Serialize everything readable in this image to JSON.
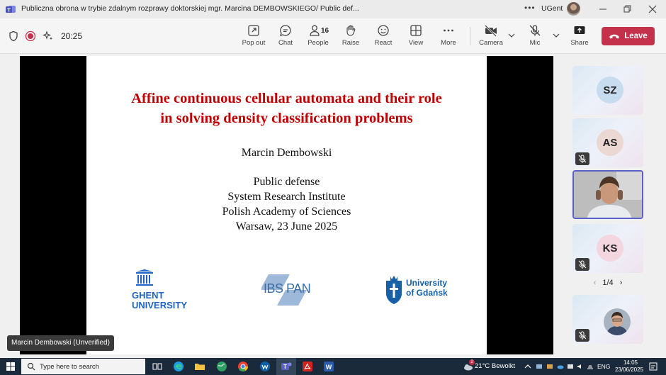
{
  "window": {
    "title": "Publiczna obrona w trybie zdalnym rozprawy doktorskiej mgr. Marcina DEMBOWSKIEGO/ Public def...",
    "more": "•••",
    "org": "UGent"
  },
  "toolbar": {
    "timer": "20:25",
    "buttons": {
      "popout": "Pop out",
      "chat": "Chat",
      "people": "People",
      "raise": "Raise",
      "react": "React",
      "view": "View",
      "more": "More",
      "camera": "Camera",
      "mic": "Mic",
      "share": "Share"
    },
    "people_count": "16",
    "leave": "Leave"
  },
  "slide": {
    "title_line1": "Affine continuous cellular automata and their role",
    "title_line2": "in solving density classification problems",
    "author": "Marcin Dembowski",
    "lines": [
      "Public defense",
      "System Research Institute",
      "Polish Academy of Sciences",
      "Warsaw, 23 June 2025"
    ],
    "logos": {
      "ghent_line1": "GHENT",
      "ghent_line2": "UNIVERSITY",
      "ibspan": "IBS PAN",
      "ug_line1": "University",
      "ug_line2": "of Gdańsk"
    },
    "title_color": "#c00000"
  },
  "speaker": {
    "name": "Marcin Dembowski (Unverified)"
  },
  "gallery": {
    "tiles": [
      {
        "initials": "SZ",
        "color": "#c7dcef"
      },
      {
        "initials": "AS",
        "color": "#ecd8d2"
      },
      {
        "initials": "KS",
        "color": "#f3d6df"
      }
    ],
    "pager": "1/4"
  },
  "taskbar": {
    "search_placeholder": "Type here to search",
    "weather": "21°C  Bewolkt",
    "lang": "ENG",
    "time": "14:05",
    "date": "23/06/2025",
    "weather_badge": "2"
  },
  "colors": {
    "accent": "#5b5fc7",
    "leave": "#c4314b"
  }
}
